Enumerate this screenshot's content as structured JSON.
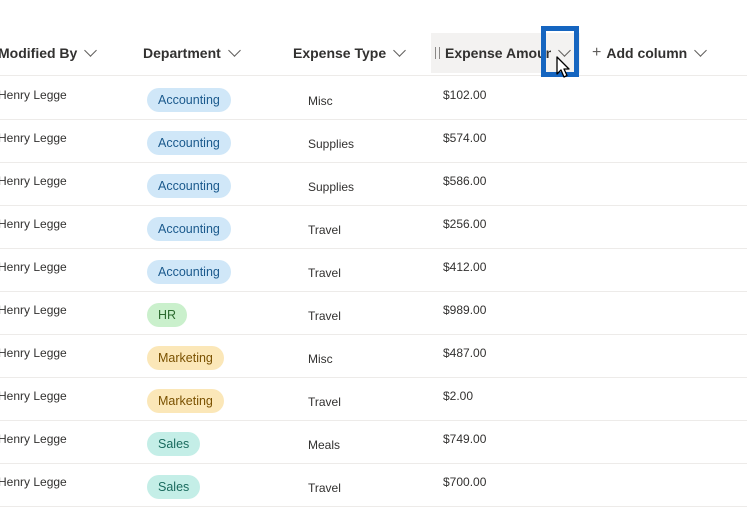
{
  "columns": {
    "modified_by": "Modified By",
    "department": "Department",
    "expense_type": "Expense Type",
    "expense_amount": "Expense Amount",
    "add_column": "Add column"
  },
  "rows": [
    {
      "modified_by": "Henry Legge",
      "department": "Accounting",
      "dept_class": "accounting",
      "expense_type": "Misc",
      "amount": "$102.00"
    },
    {
      "modified_by": "Henry Legge",
      "department": "Accounting",
      "dept_class": "accounting",
      "expense_type": "Supplies",
      "amount": "$574.00"
    },
    {
      "modified_by": "Henry Legge",
      "department": "Accounting",
      "dept_class": "accounting",
      "expense_type": "Supplies",
      "amount": "$586.00"
    },
    {
      "modified_by": "Henry Legge",
      "department": "Accounting",
      "dept_class": "accounting",
      "expense_type": "Travel",
      "amount": "$256.00"
    },
    {
      "modified_by": "Henry Legge",
      "department": "Accounting",
      "dept_class": "accounting",
      "expense_type": "Travel",
      "amount": "$412.00"
    },
    {
      "modified_by": "Henry Legge",
      "department": "HR",
      "dept_class": "hr",
      "expense_type": "Travel",
      "amount": "$989.00"
    },
    {
      "modified_by": "Henry Legge",
      "department": "Marketing",
      "dept_class": "marketing",
      "expense_type": "Misc",
      "amount": "$487.00"
    },
    {
      "modified_by": "Henry Legge",
      "department": "Marketing",
      "dept_class": "marketing",
      "expense_type": "Travel",
      "amount": "$2.00"
    },
    {
      "modified_by": "Henry Legge",
      "department": "Sales",
      "dept_class": "sales",
      "expense_type": "Meals",
      "amount": "$749.00"
    },
    {
      "modified_by": "Henry Legge",
      "department": "Sales",
      "dept_class": "sales",
      "expense_type": "Travel",
      "amount": "$700.00"
    }
  ],
  "colors": {
    "accounting": "#d0e7f8",
    "hr": "#caf0cc",
    "marketing": "#fbe7b8",
    "sales": "#c4eee7",
    "highlight": "#1565c0"
  }
}
